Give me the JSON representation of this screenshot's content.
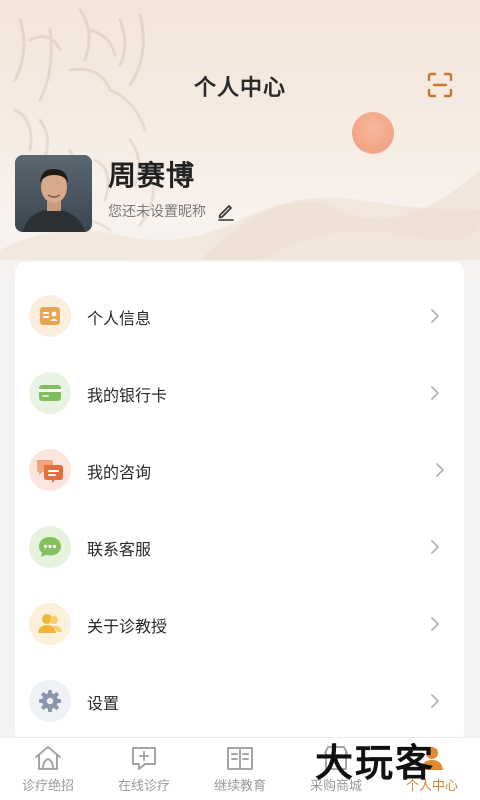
{
  "header": {
    "title": "个人中心",
    "scan_icon": "scan-icon"
  },
  "profile": {
    "name": "周赛博",
    "nickname_hint": "您还未设置昵称",
    "edit_icon": "pencil-icon"
  },
  "menu": [
    {
      "label": "个人信息",
      "icon": "id-card-icon",
      "bg": "#fbeede",
      "color": "#e9a44f"
    },
    {
      "label": "我的银行卡",
      "icon": "bank-card-icon",
      "bg": "#e9f3e3",
      "color": "#7fbf5f"
    },
    {
      "label": "我的咨询",
      "icon": "chat-bubbles-icon",
      "bg": "#fbe6dd",
      "color": "#e57a4a"
    },
    {
      "label": "联系客服",
      "icon": "message-dots-icon",
      "bg": "#e6f2de",
      "color": "#82bf5c"
    },
    {
      "label": "关于诊教授",
      "icon": "users-icon",
      "bg": "#fbf0d9",
      "color": "#efb63e"
    },
    {
      "label": "设置",
      "icon": "gear-icon",
      "bg": "#eef1f6",
      "color": "#8a97ab"
    }
  ],
  "tabbar": [
    {
      "label": "诊疗绝招",
      "icon": "mortar-house-icon",
      "active": false
    },
    {
      "label": "在线诊疗",
      "icon": "consult-plus-icon",
      "active": false
    },
    {
      "label": "继续教育",
      "icon": "book-icon",
      "active": false
    },
    {
      "label": "采购商城",
      "icon": "shop-icon",
      "active": false
    },
    {
      "label": "个人中心",
      "icon": "person-icon",
      "active": true
    }
  ],
  "watermark": "大玩客",
  "colors": {
    "accent": "#d9822b",
    "inactive_tab": "#9a9a9a"
  }
}
